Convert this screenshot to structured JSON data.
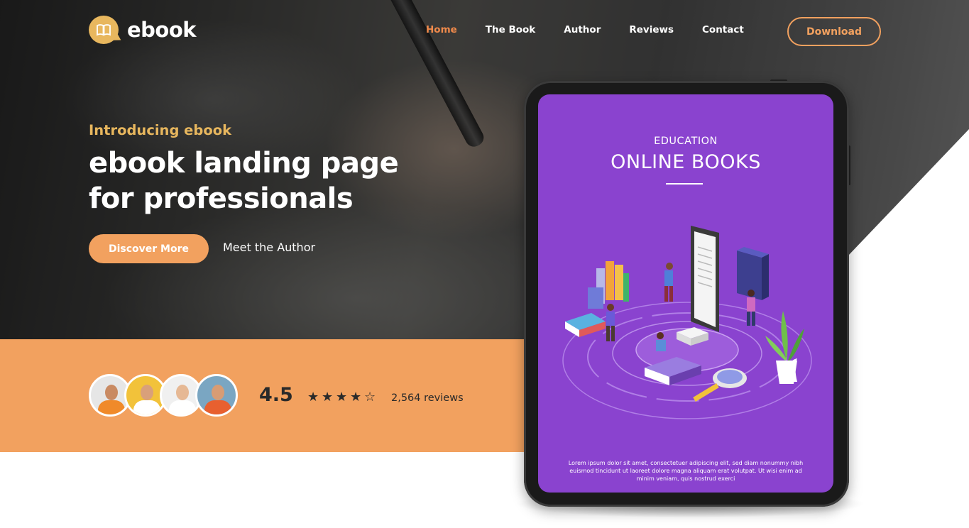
{
  "brand": {
    "name": "ebook",
    "icon": "open-book-icon",
    "color": "#e8b75e"
  },
  "nav": {
    "items": [
      {
        "label": "Home",
        "active": true
      },
      {
        "label": "The Book",
        "active": false
      },
      {
        "label": "Author",
        "active": false
      },
      {
        "label": "Reviews",
        "active": false
      },
      {
        "label": "Contact",
        "active": false
      }
    ],
    "download_label": "Download"
  },
  "hero": {
    "intro": "Introducing ebook",
    "headline_line1": "ebook landing page",
    "headline_line2": "for professionals",
    "primary_cta": "Discover More",
    "secondary_cta": "Meet the Author"
  },
  "reviews": {
    "rating": "4.5",
    "stars_filled": 4,
    "stars_total": 5,
    "count_label": "2,564 reviews",
    "avatars": [
      {
        "name": "reviewer-avatar-1",
        "bg": "#e6e6e6",
        "shirt": "#f08a2a"
      },
      {
        "name": "reviewer-avatar-2",
        "bg": "#f2c23a",
        "shirt": "#ffffff"
      },
      {
        "name": "reviewer-avatar-3",
        "bg": "#f0f0f0",
        "shirt": "#ffffff"
      },
      {
        "name": "reviewer-avatar-4",
        "bg": "#7aa6c2",
        "shirt": "#e8602f"
      }
    ]
  },
  "tablet_cover": {
    "category": "EDUCATION",
    "title": "ONLINE BOOKS",
    "body": "Lorem ipsum dolor sit amet, consectetuer adipiscing elit, sed diam nonummy nibh euismod tincidunt ut laoreet dolore magna aliquam erat volutpat. Ut wisi enim ad minim veniam, quis nostrud exerci",
    "screen_color": "#8a43cf"
  },
  "colors": {
    "accent_orange": "#f2a15f",
    "active_nav": "#f08a4b",
    "gold": "#e8b75e",
    "band": "#f2a15f"
  }
}
